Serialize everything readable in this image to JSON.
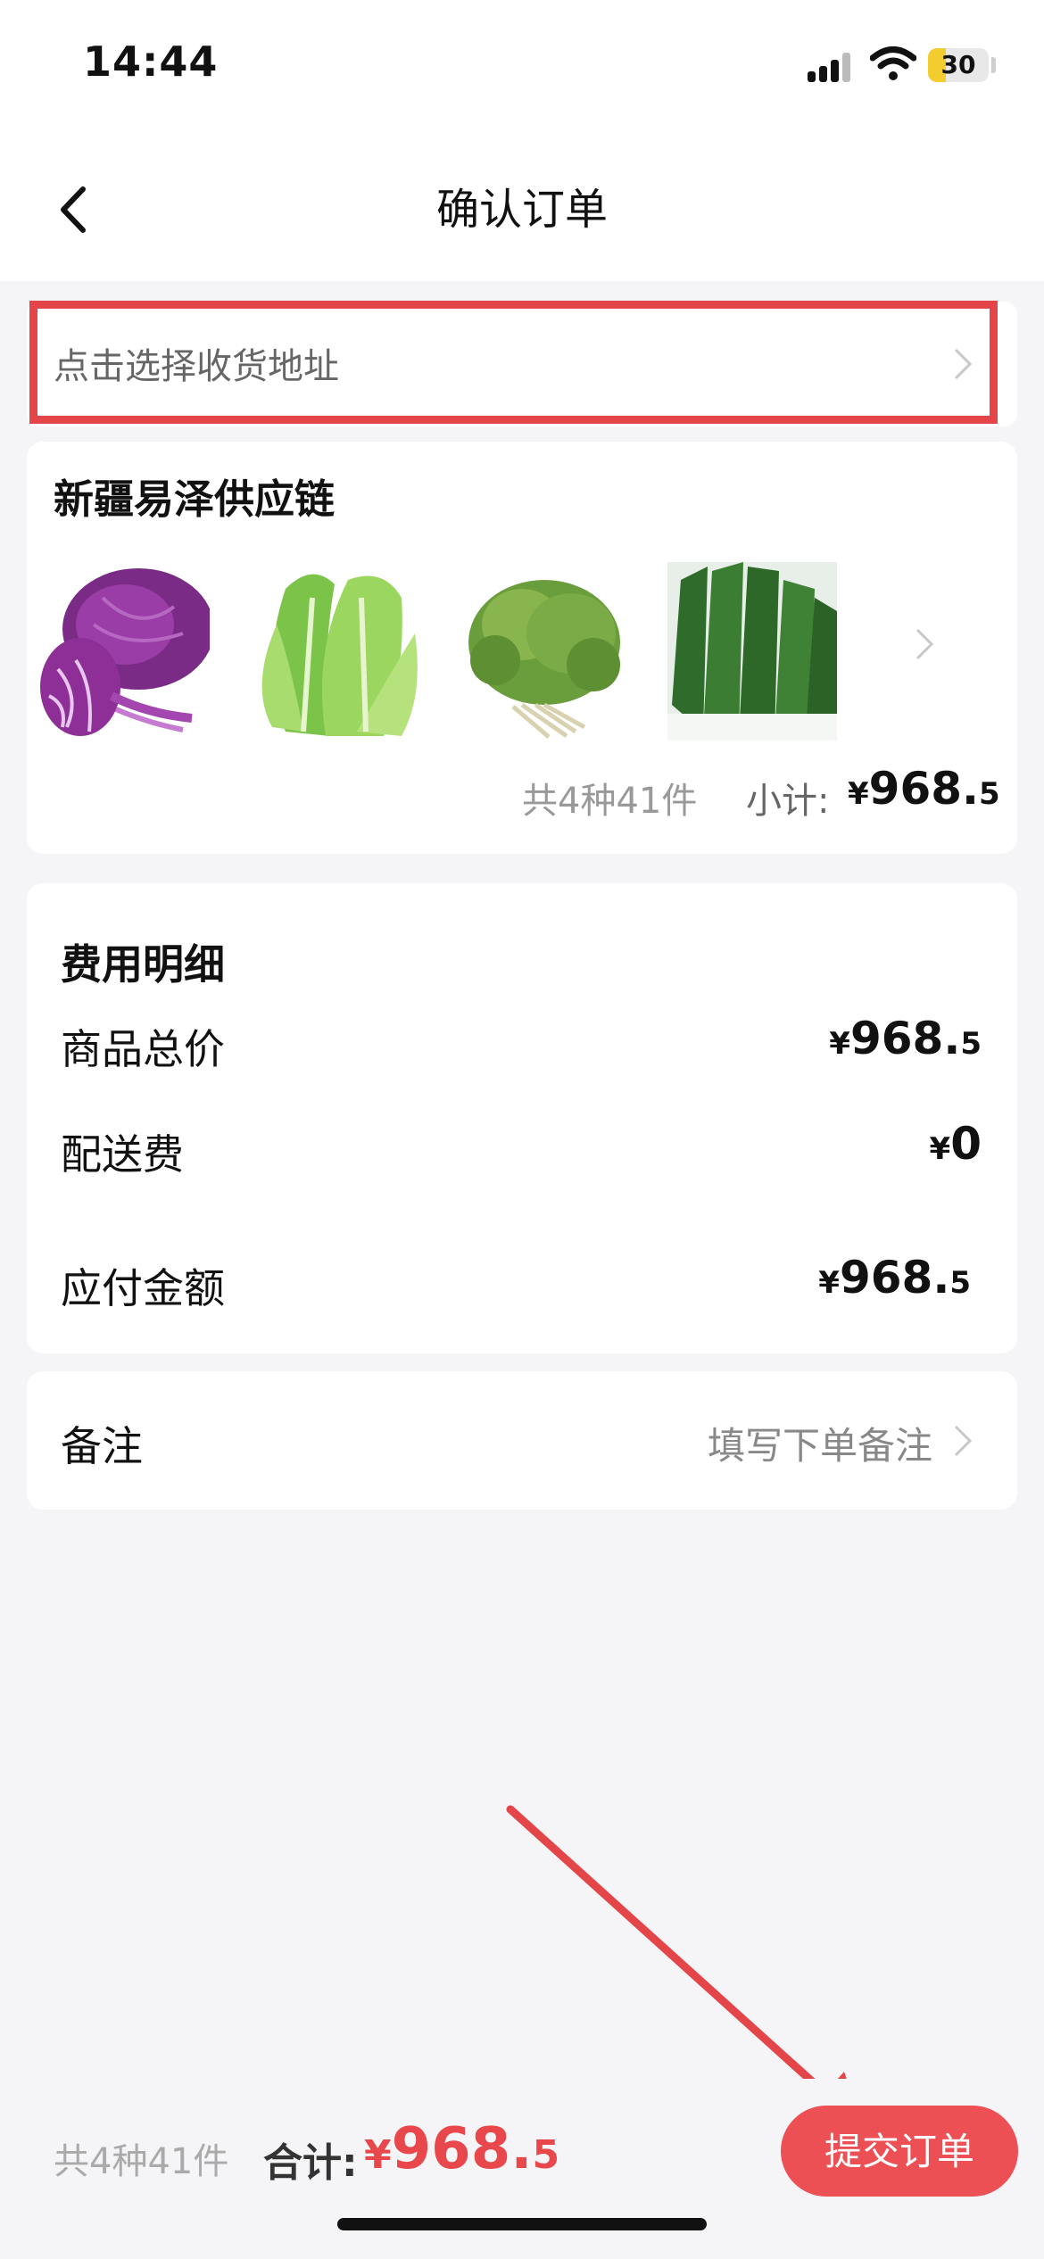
{
  "status_bar": {
    "time": "14:44",
    "battery": "30",
    "battery_level": 0.3
  },
  "nav": {
    "title": "确认订单",
    "back_icon": "chevron-left-icon"
  },
  "address": {
    "placeholder": "点击选择收货地址"
  },
  "shop": {
    "name": "新疆易泽供应链",
    "products": [
      {
        "name": "red-cabbage-image"
      },
      {
        "name": "romaine-lettuce-image"
      },
      {
        "name": "frisee-lettuce-image"
      },
      {
        "name": "leaf-lettuce-image"
      }
    ],
    "summary": "共4种41件",
    "subtotal_label": "小计:",
    "subtotal_yen": "¥",
    "subtotal_int": "968.",
    "subtotal_dec": "5"
  },
  "fees": {
    "title": "费用明细",
    "items": [
      {
        "label": "商品总价",
        "yen": "¥",
        "int": "968.",
        "dec": "5"
      },
      {
        "label": "配送费",
        "yen": "¥",
        "int": "0",
        "dec": ""
      },
      {
        "label": "应付金额",
        "yen": "¥",
        "int": "968.",
        "dec": "5"
      }
    ]
  },
  "remark": {
    "label": "备注",
    "placeholder": "填写下单备注"
  },
  "bottom": {
    "count": "共4种41件",
    "total_label": "合计:",
    "total_yen": "¥",
    "total_int": "968.",
    "total_dec": "5",
    "submit": "提交订单"
  },
  "colors": {
    "accent": "#ec5054",
    "highlight": "#e34548",
    "price_red": "#e8474b"
  }
}
